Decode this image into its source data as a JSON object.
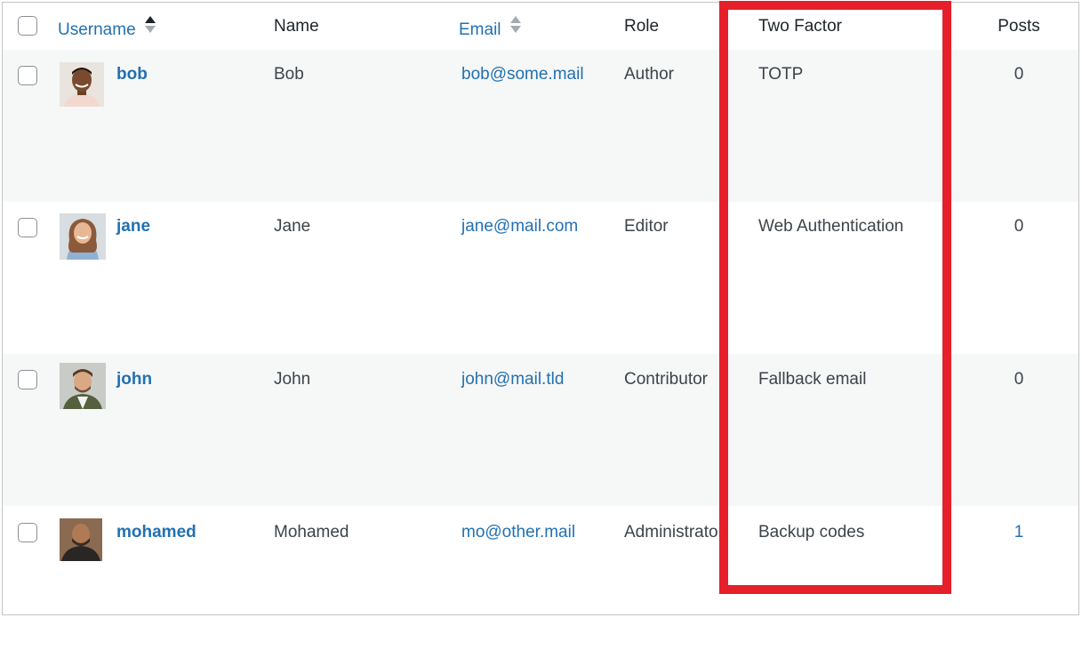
{
  "columns": {
    "username": "Username",
    "name": "Name",
    "email": "Email",
    "role": "Role",
    "two_factor": "Two Factor",
    "posts": "Posts"
  },
  "sort": {
    "username_icon": "sort-ascending-icon",
    "email_icon": "sort-neutral-icon"
  },
  "users": [
    {
      "username": "bob",
      "name": "Bob",
      "email": "bob@some.mail",
      "role": "Author",
      "two_factor": "TOTP",
      "posts": "0"
    },
    {
      "username": "jane",
      "name": "Jane",
      "email": "jane@mail.com",
      "role": "Editor",
      "two_factor": "Web Authentication",
      "posts": "0"
    },
    {
      "username": "john",
      "name": "John",
      "email": "john@mail.tld",
      "role": "Contributor",
      "two_factor": "Fallback email",
      "posts": "0"
    },
    {
      "username": "mohamed",
      "name": "Mohamed",
      "email": "mo@other.mail",
      "role": "Administrator",
      "two_factor": "Backup codes",
      "posts": "1"
    }
  ],
  "colors": {
    "link": "#2271b1",
    "highlight": "#e5202b",
    "alt_row": "#f6f7f7"
  }
}
